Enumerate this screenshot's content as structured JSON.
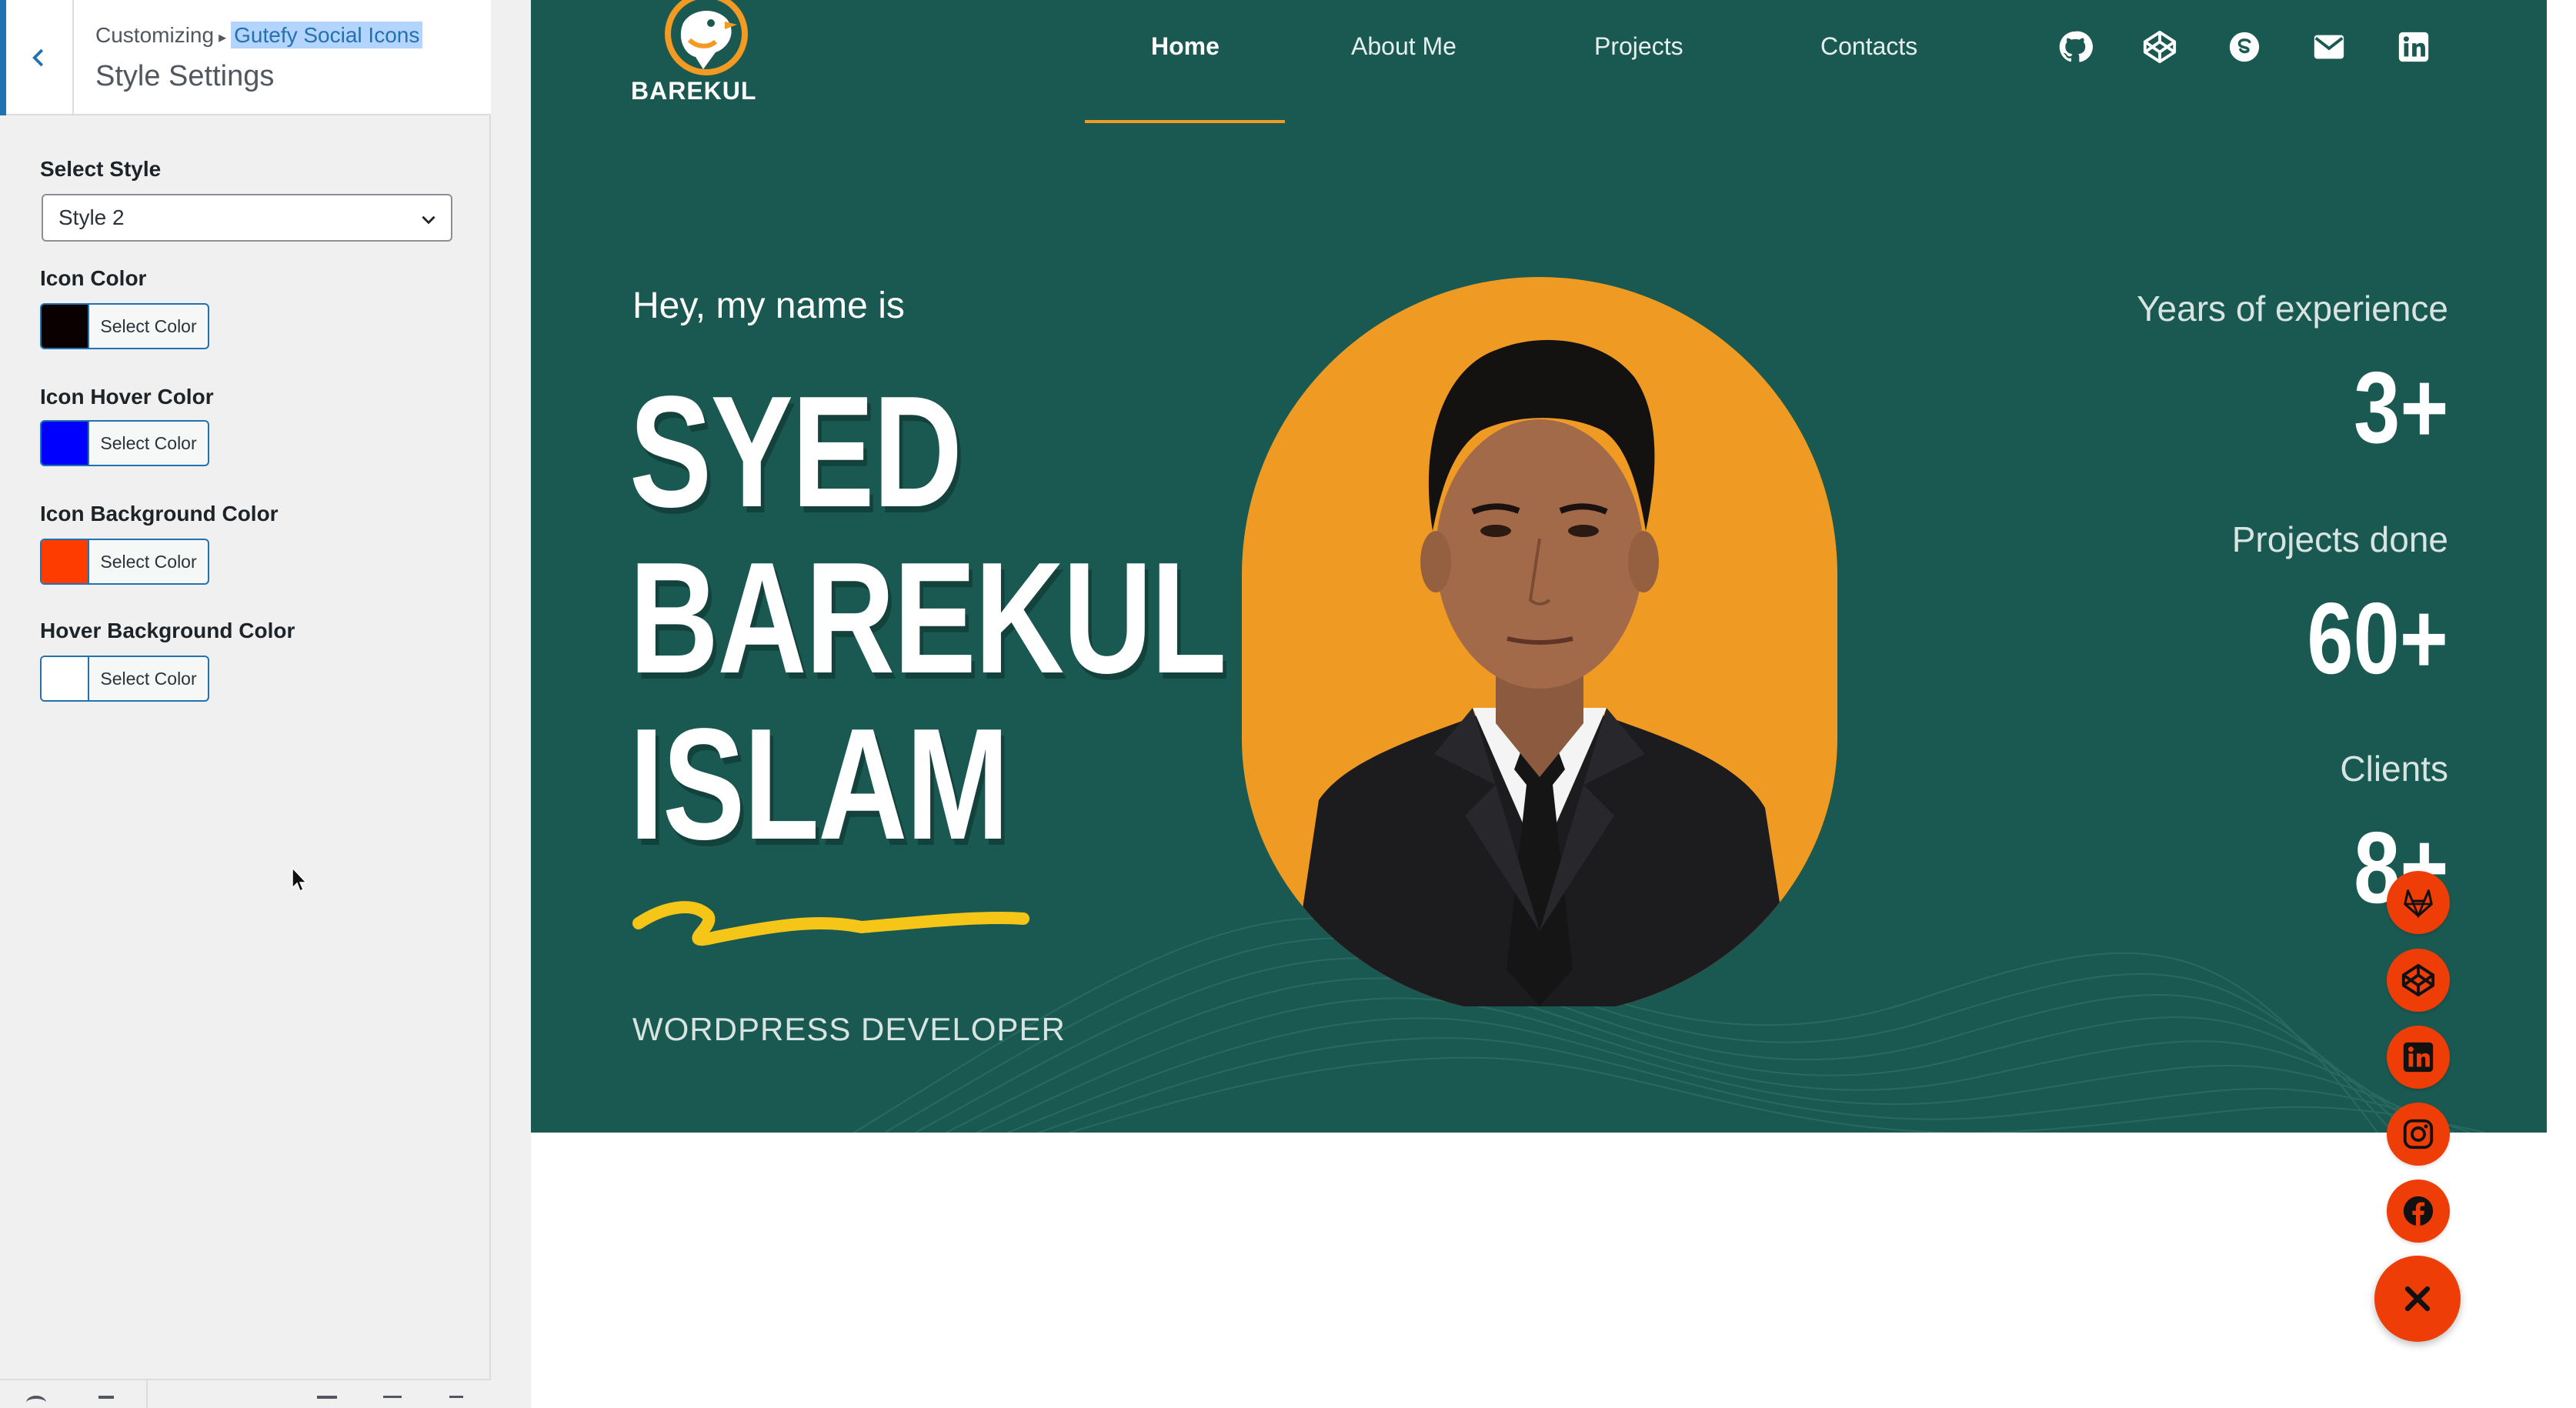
{
  "customizer": {
    "breadcrumb_prefix": "Customizing",
    "breadcrumb_separator": "▸",
    "breadcrumb_section": "Gutefy Social Icons",
    "section_title": "Style Settings",
    "select_style": {
      "label": "Select Style",
      "value": "Style 2"
    },
    "colors": [
      {
        "label": "Icon Color",
        "button_label": "Select Color",
        "swatch": "#0a0000"
      },
      {
        "label": "Icon Hover Color",
        "button_label": "Select Color",
        "swatch": "#0000ff"
      },
      {
        "label": "Icon Background Color",
        "button_label": "Select Color",
        "swatch": "#ff3c00"
      },
      {
        "label": "Hover Background Color",
        "button_label": "Select Color",
        "swatch": "#ffffff"
      }
    ]
  },
  "site": {
    "logo_text": "BAREKUL",
    "nav": [
      {
        "label": "Home",
        "active": true
      },
      {
        "label": "About Me",
        "active": false
      },
      {
        "label": "Projects",
        "active": false
      },
      {
        "label": "Contacts",
        "active": false
      }
    ],
    "header_icons": [
      "github-icon",
      "codepen-icon",
      "skype-icon",
      "mail-icon",
      "linkedin-icon"
    ],
    "hero": {
      "greeting": "Hey, my name is",
      "name_lines": [
        "SYED",
        "BAREKUL",
        "ISLAM"
      ],
      "role": "WORDPRESS DEVELOPER"
    },
    "stats": [
      {
        "label": "Years of experience",
        "value": "3+"
      },
      {
        "label": "Projects done",
        "value": "60+"
      },
      {
        "label": "Clients",
        "value": "8+"
      }
    ],
    "floating_icons": [
      "gitlab-icon",
      "codepen-icon",
      "linkedin-icon",
      "instagram-icon",
      "facebook-icon"
    ],
    "close_icon": "close-icon"
  },
  "colors": {
    "hero_bg": "#1a5951",
    "accent_orange": "#f29a21",
    "social_bg": "#ee3d07",
    "wp_blue": "#2271b1"
  }
}
